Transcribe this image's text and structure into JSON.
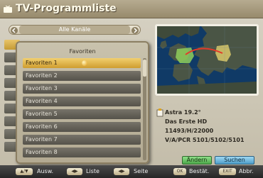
{
  "title": "TV-Programmliste",
  "category": {
    "label": "Alle Kanäle"
  },
  "popup": {
    "header": "Favoriten",
    "items": [
      {
        "label": "Favoriten 1",
        "selected": true
      },
      {
        "label": "Favoriten 2"
      },
      {
        "label": "Favoriten 3"
      },
      {
        "label": "Favoriten 4"
      },
      {
        "label": "Favoriten 5"
      },
      {
        "label": "Favoriten 6"
      },
      {
        "label": "Favoriten 7"
      },
      {
        "label": "Favoriten 8"
      }
    ]
  },
  "satellite": {
    "name": "Astra 19.2°",
    "channel": "Das Erste HD",
    "transponder": "11493/H/22000",
    "pids": "V/A/PCR 5101/5102/5101"
  },
  "buttons": {
    "andern": "Ändern",
    "suchen": "Suchen"
  },
  "keybar": {
    "items": [
      {
        "key": "▲/▼",
        "label": "Ausw."
      },
      {
        "key": "◀▶",
        "label": "Liste"
      },
      {
        "key": "◀▶",
        "label": "Seite"
      },
      {
        "key": "OK",
        "label": "Bestät."
      },
      {
        "key": "EXIT",
        "label": "Abbr."
      }
    ]
  },
  "colors": {
    "title_bar": "#978a6c",
    "selected_row": "#e3b34a",
    "row": "#666259",
    "andern_green": "#5fbf5a",
    "suchen_blue": "#5aaad6",
    "map_sea": "#0f2e52"
  },
  "icons": [
    "tv-icon",
    "chevron-left-icon",
    "chevron-right-icon",
    "favorite-star-icon",
    "satellite-icon"
  ]
}
